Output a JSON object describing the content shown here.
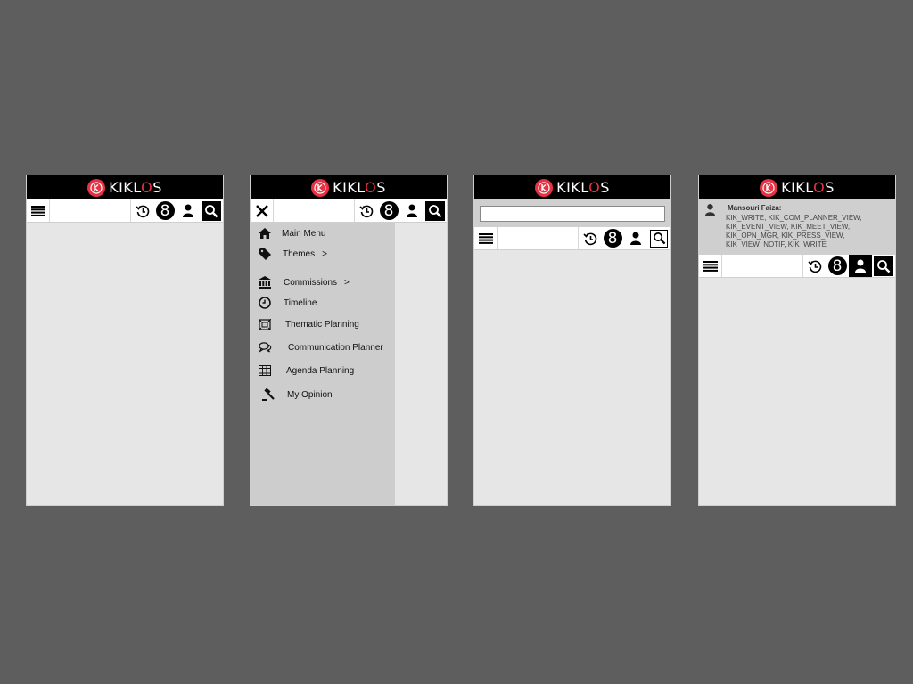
{
  "brand": {
    "name_pre": "KIKL",
    "name_o": "O",
    "name_post": "S",
    "accent": "#e63244"
  },
  "toolbar": {
    "notification_count": "8"
  },
  "menu": {
    "items": [
      {
        "label": "Main Menu",
        "icon": "home-icon"
      },
      {
        "label": "Themes",
        "icon": "tag-icon",
        "has_submenu": true
      },
      {
        "label": "Commissions",
        "icon": "institution-icon",
        "has_submenu": true
      },
      {
        "label": "Timeline",
        "icon": "clock-icon"
      },
      {
        "label": "Thematic Planning",
        "icon": "planning-icon"
      },
      {
        "label": "Communication Planner",
        "icon": "chat-icon"
      },
      {
        "label": "Agenda Planning",
        "icon": "table-icon"
      },
      {
        "label": "My Opinion",
        "icon": "gavel-icon"
      }
    ]
  },
  "search": {
    "value": ""
  },
  "user": {
    "name": "Mansouri Faiza:",
    "permissions_lines": [
      "KIK_WRITE, KIK_COM_PLANNER_VIEW,",
      "KIK_EVENT_VIEW, KIK_MEET_VIEW,",
      "KIK_OPN_MGR, KIK_PRESS_VIEW,",
      "KIK_VIEW_NOTIF, KIK_WRITE"
    ]
  }
}
